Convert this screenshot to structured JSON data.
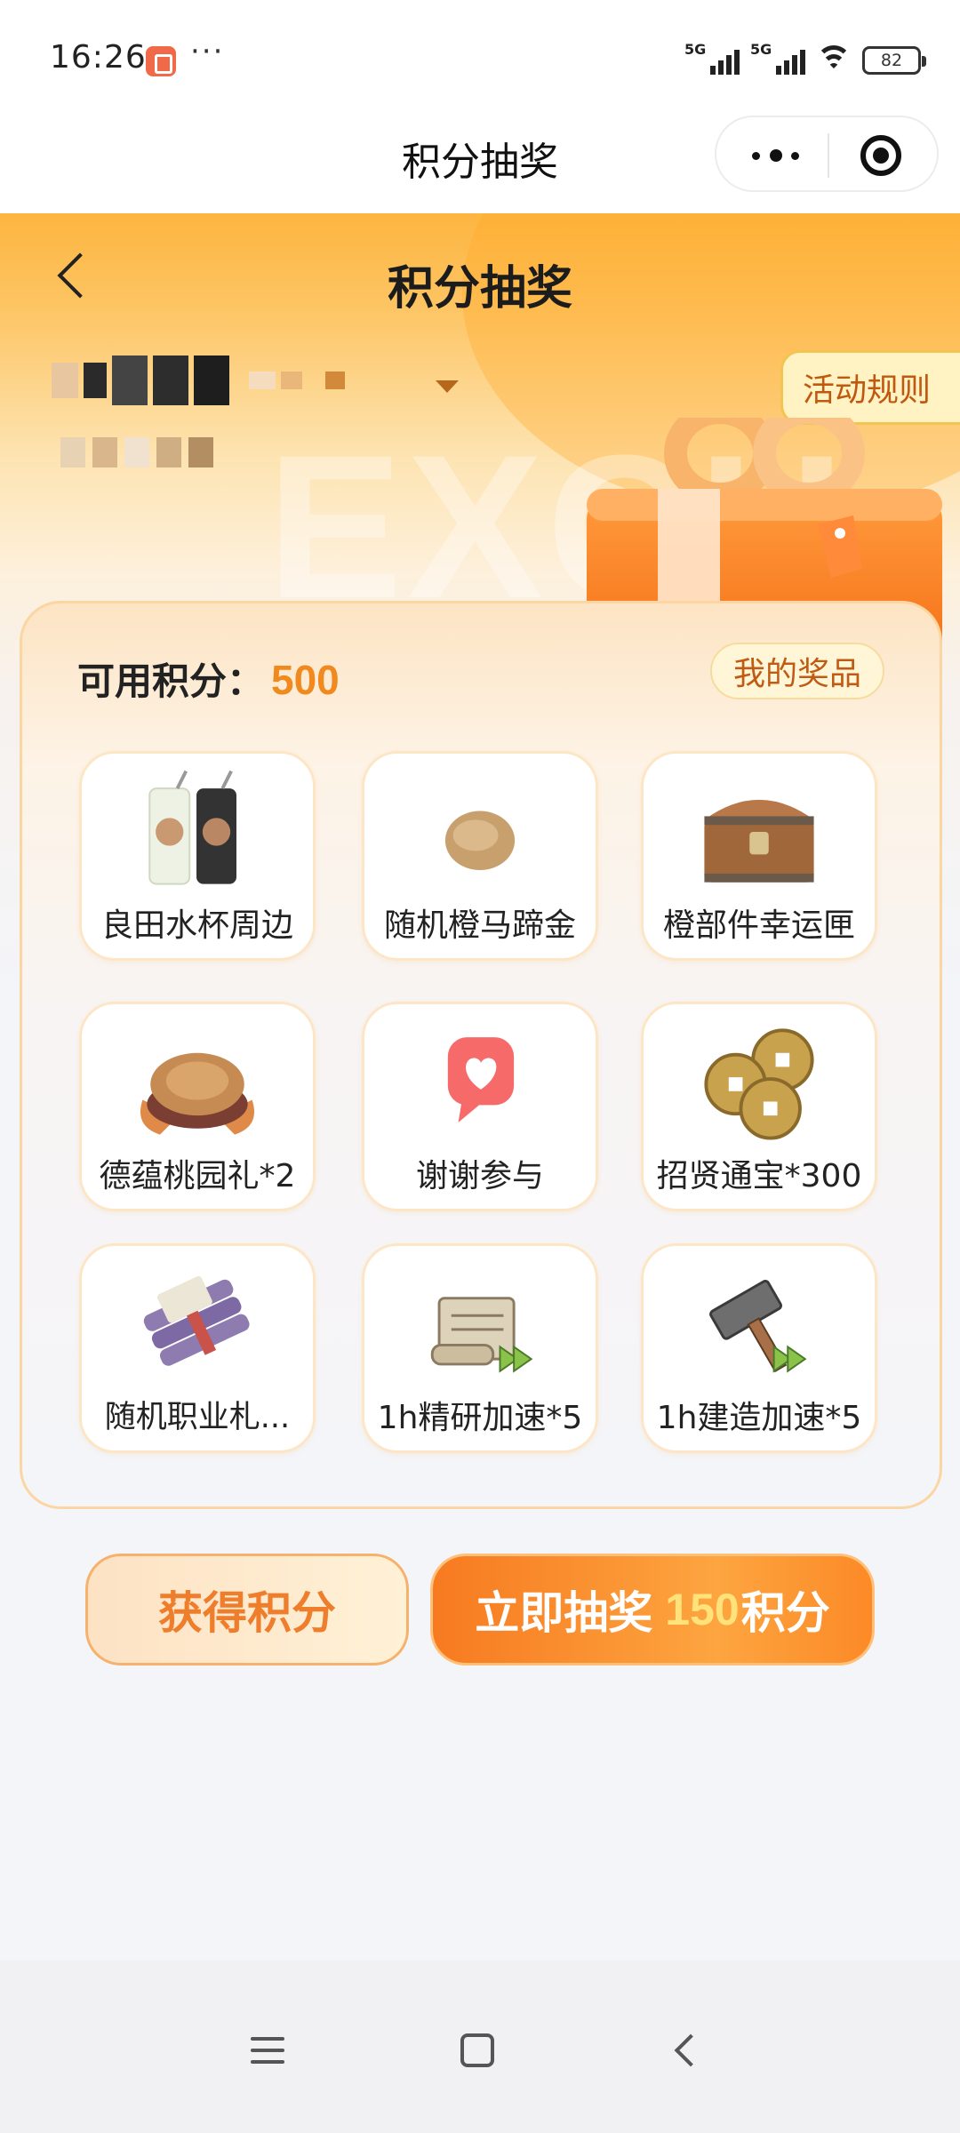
{
  "status_bar": {
    "time": "16:26",
    "signal_1": "5G",
    "signal_2": "5G",
    "battery": "82"
  },
  "mini_program": {
    "title": "积分抽奖"
  },
  "header": {
    "title": "积分抽奖",
    "rules_label": "活动规则"
  },
  "card": {
    "points_label": "可用积分：",
    "points_value": "500",
    "my_prizes_label": "我的奖品"
  },
  "prizes": [
    {
      "name": "良田水杯周边",
      "icon": "cups-icon"
    },
    {
      "name": "随机橙马蹄金",
      "icon": "gold-ingot-icon"
    },
    {
      "name": "橙部件幸运匣",
      "icon": "treasure-chest-icon"
    },
    {
      "name": "德蕴桃园礼*2",
      "icon": "gift-plate-icon"
    },
    {
      "name": "谢谢参与",
      "icon": "heart-bubble-icon"
    },
    {
      "name": "招贤通宝*300",
      "icon": "coins-icon"
    },
    {
      "name": "随机职业札...",
      "icon": "scroll-bundle-icon"
    },
    {
      "name": "1h精研加速*5",
      "icon": "scroll-speedup-icon"
    },
    {
      "name": "1h建造加速*5",
      "icon": "hammer-speedup-icon"
    }
  ],
  "actions": {
    "earn_label": "获得积分",
    "draw_label": "立即抽奖",
    "draw_cost": "150",
    "draw_unit": "积分"
  },
  "colors": {
    "accent_orange": "#f08a1e",
    "header_gradient_top": "#fdb540",
    "draw_button": "#f77a20"
  }
}
